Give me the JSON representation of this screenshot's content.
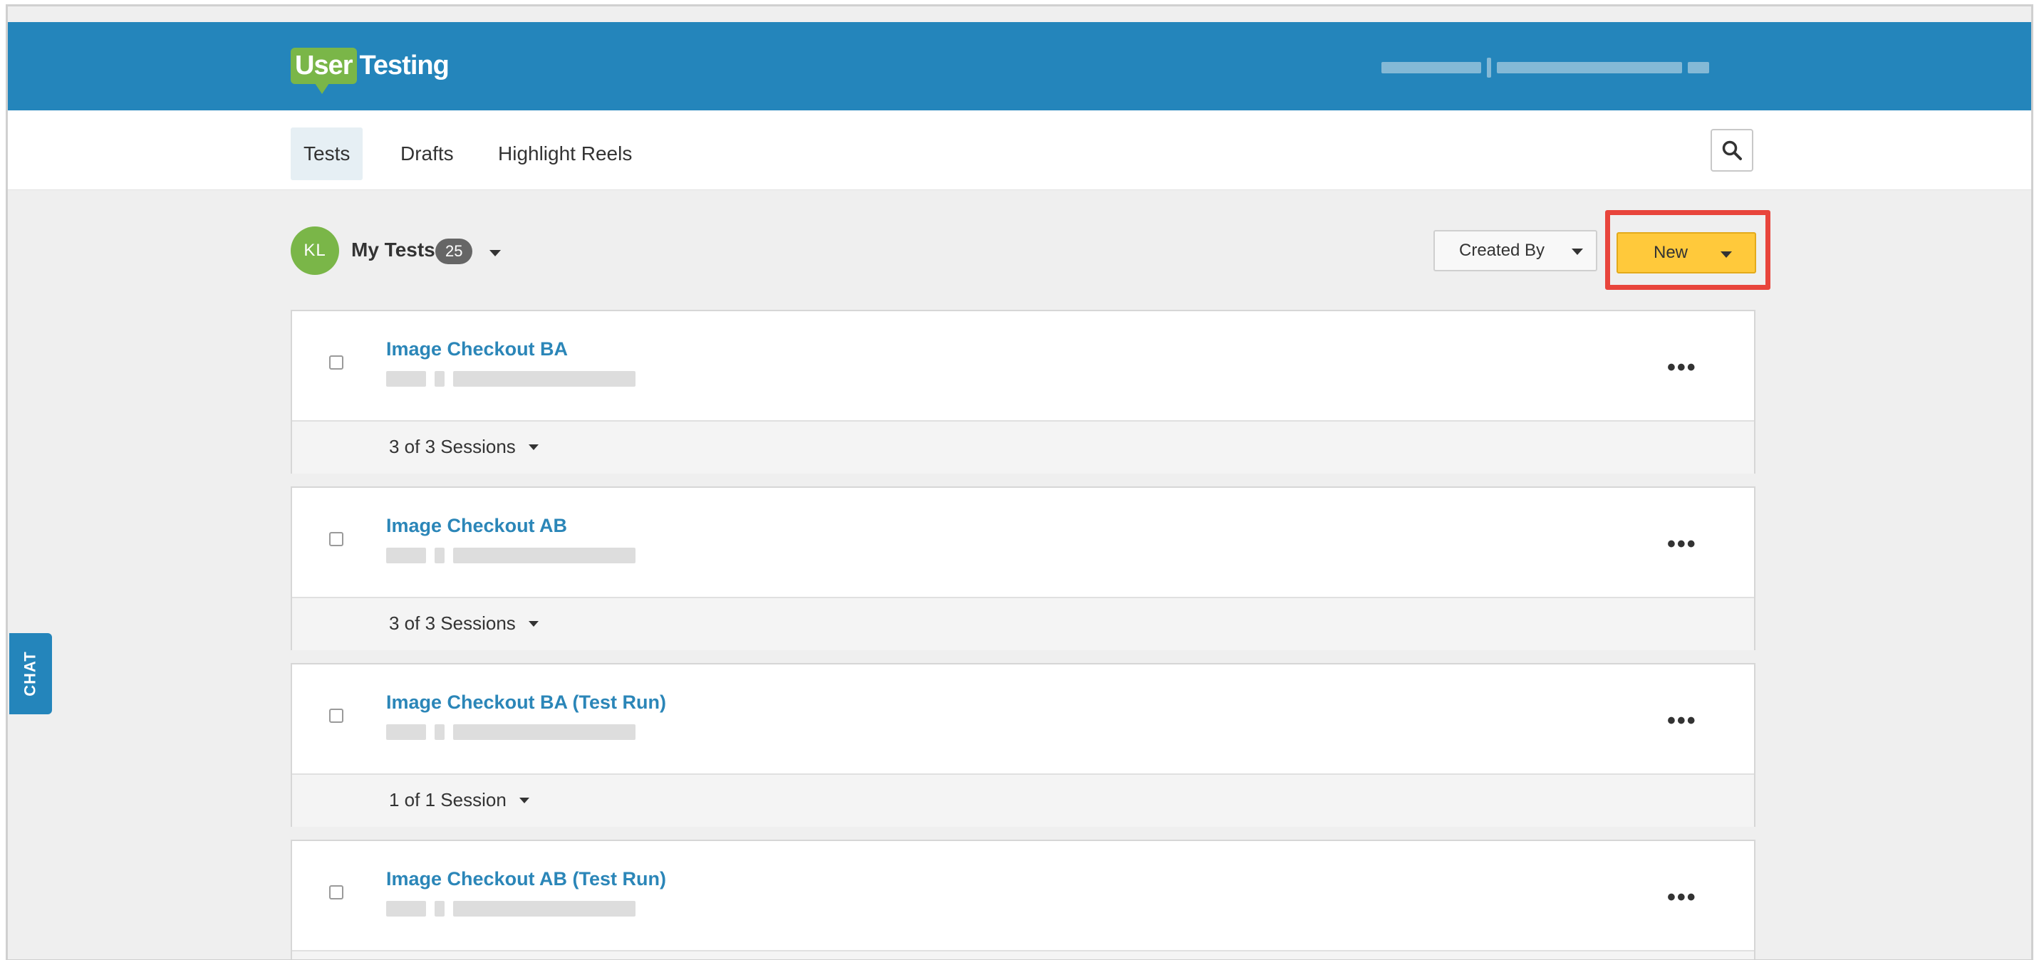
{
  "brand": {
    "logo_user": "User",
    "logo_testing": "Testing",
    "primary_color": "#2485bb",
    "logo_green": "#7ab648"
  },
  "nav": {
    "tabs": [
      {
        "label": "Tests",
        "active": true
      },
      {
        "label": "Drafts",
        "active": false
      },
      {
        "label": "Highlight Reels",
        "active": false
      }
    ],
    "search_icon": "search-icon"
  },
  "header": {
    "avatar_initials": "KL",
    "title": "My Tests",
    "count": "25",
    "created_by_label": "Created By",
    "new_label": "New",
    "new_color": "#ffc93b",
    "highlight_color": "#e8453c"
  },
  "tests": [
    {
      "title": "Image Checkout BA",
      "sessions": "3 of 3 Sessions"
    },
    {
      "title": "Image Checkout AB",
      "sessions": "3 of 3 Sessions"
    },
    {
      "title": "Image Checkout BA (Test Run)",
      "sessions": "1 of 1 Session"
    },
    {
      "title": "Image Checkout AB (Test Run)",
      "sessions": ""
    }
  ],
  "chat": {
    "label": "CHAT"
  }
}
